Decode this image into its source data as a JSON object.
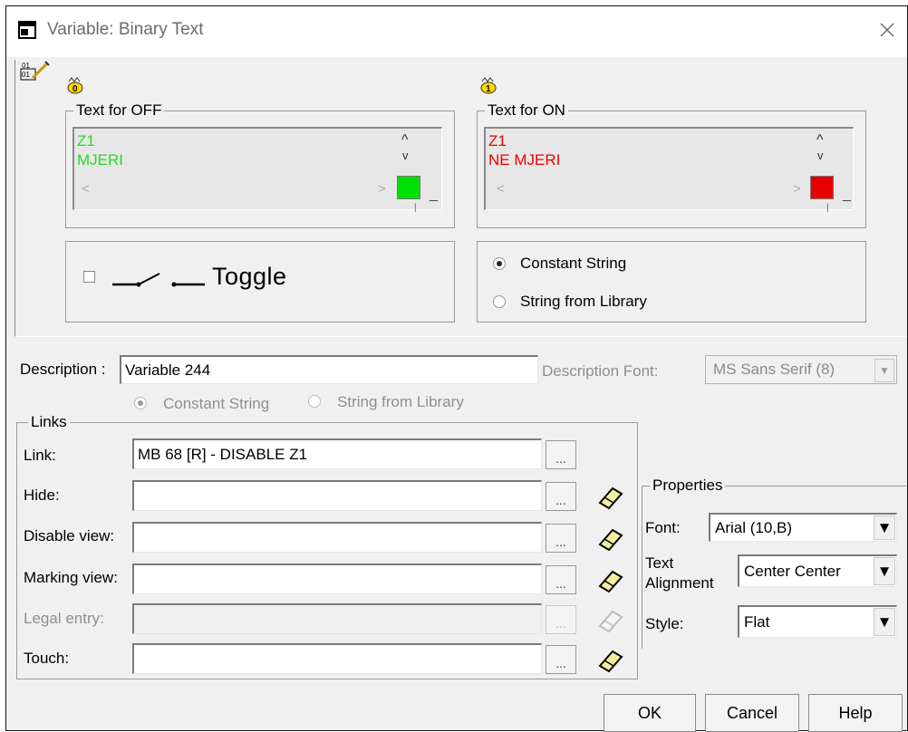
{
  "window": {
    "title": "Variable: Binary Text"
  },
  "off_group": {
    "legend": "Text for OFF",
    "lines": [
      "Z1",
      "MJERI"
    ],
    "text_color": "#22dd22",
    "swatch_color": "#00e000"
  },
  "on_group": {
    "legend": "Text for ON",
    "lines": [
      "Z1",
      "NE MJERI"
    ],
    "text_color": "#ee0000",
    "swatch_color": "#e80000"
  },
  "toggle": {
    "label": "Toggle",
    "checked": false
  },
  "string_source": {
    "options": [
      "Constant String",
      "String from Library"
    ],
    "selected": "Constant String"
  },
  "description": {
    "label": "Description :",
    "value": "Variable 244",
    "font_label": "Description Font:",
    "font_value": "MS Sans Serif (8)",
    "options": [
      "Constant String",
      "String from Library"
    ],
    "selected": "Constant String"
  },
  "links": {
    "legend": "Links",
    "rows": [
      {
        "label": "Link:",
        "value": "MB 68 [R] - DISABLE Z1",
        "disabled": false,
        "eraser": false
      },
      {
        "label": "Hide:",
        "value": "",
        "disabled": false,
        "eraser": true
      },
      {
        "label": "Disable view:",
        "value": "",
        "disabled": false,
        "eraser": true
      },
      {
        "label": "Marking view:",
        "value": "",
        "disabled": false,
        "eraser": true
      },
      {
        "label": "Legal entry:",
        "value": "",
        "disabled": true,
        "eraser": true
      },
      {
        "label": "Touch:",
        "value": "",
        "disabled": false,
        "eraser": true
      }
    ],
    "browse_label": "..."
  },
  "properties": {
    "legend": "Properties",
    "font_label": "Font:",
    "font_value": "Arial (10,B)",
    "alignment_label_1": "Text",
    "alignment_label_2": "Alignment",
    "alignment_value": "Center Center",
    "style_label": "Style:",
    "style_value": "Flat"
  },
  "buttons": {
    "ok": "OK",
    "cancel": "Cancel",
    "help": "Help"
  }
}
